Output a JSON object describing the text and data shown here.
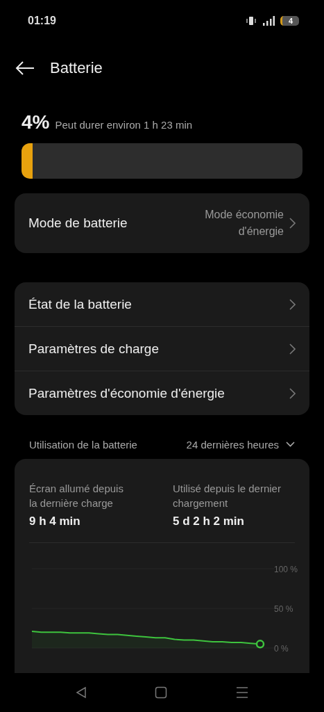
{
  "status_bar": {
    "time": "01:19",
    "battery": "4"
  },
  "header": {
    "title": "Batterie"
  },
  "battery": {
    "percent": "4%",
    "estimate": "Peut durer environ 1 h 23 min",
    "level": 0.04
  },
  "mode_card": {
    "label": "Mode de batterie",
    "value": "Mode économie d'énergie"
  },
  "settings": [
    {
      "label": "État de la batterie"
    },
    {
      "label": "Paramètres de charge"
    },
    {
      "label": "Paramètres d'économie d'énergie"
    }
  ],
  "usage": {
    "title": "Utilisation de la batterie",
    "period": "24 dernières heures",
    "stats": [
      {
        "label": "Écran allumé depuis la dernière charge",
        "value": "9 h 4 min"
      },
      {
        "label": "Utilisé depuis le dernier chargement",
        "value": "5 d 2 h 2 min"
      }
    ],
    "chart_data": {
      "type": "area",
      "ylim": [
        0,
        100
      ],
      "yticks": [
        {
          "value": 0,
          "label": "0 %"
        },
        {
          "value": 50,
          "label": "50 %"
        },
        {
          "value": 100,
          "label": "100 %"
        }
      ],
      "series": [
        {
          "color": "#3ec43e",
          "values": [
            21,
            20,
            20,
            20,
            19,
            19,
            19,
            18,
            17,
            17,
            16,
            15,
            14,
            13,
            13,
            11,
            10,
            10,
            9,
            8,
            8,
            7,
            7,
            6,
            5
          ]
        }
      ]
    }
  }
}
